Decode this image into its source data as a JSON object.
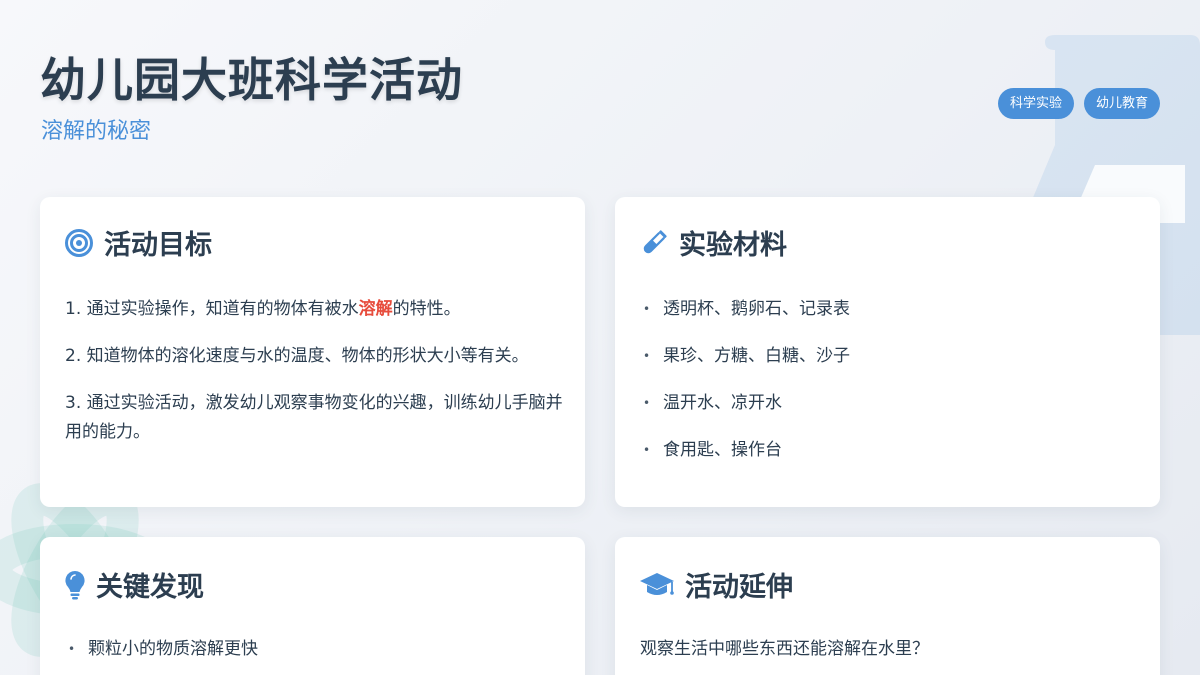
{
  "header": {
    "title": "幼儿园大班科学活动",
    "subtitle": "溶解的秘密",
    "tags": [
      "科学实验",
      "幼儿教育"
    ]
  },
  "goals_card": {
    "title": "活动目标",
    "icon": "target-icon",
    "item1_prefix": "1. 通过实验操作，知道有的物体有被水",
    "item1_highlight": "溶解",
    "item1_suffix": "的特性。",
    "item2": "2. 知道物体的溶化速度与水的温度、物体的形状大小等有关。",
    "item3": "3. 通过实验活动，激发幼儿观察事物变化的兴趣，训练幼儿手脑并用的能力。"
  },
  "materials_card": {
    "title": "实验材料",
    "icon": "test-tube-icon",
    "items": [
      "透明杯、鹅卵石、记录表",
      "果珍、方糖、白糖、沙子",
      "温开水、凉开水",
      "食用匙、操作台"
    ]
  },
  "findings_card": {
    "title": "关键发现",
    "icon": "lightbulb-icon",
    "items": [
      "颗粒小的物质溶解更快"
    ]
  },
  "extension_card": {
    "title": "活动延伸",
    "icon": "graduation-cap-icon",
    "text": "观察生活中哪些东西还能溶解在水里？"
  },
  "colors": {
    "accent": "#4a90d9",
    "title": "#2c3e50",
    "highlight": "#e74c3c"
  }
}
